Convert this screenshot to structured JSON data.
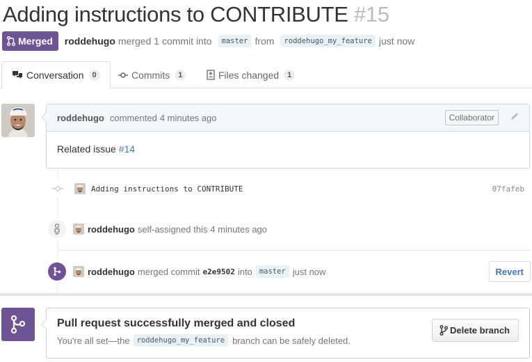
{
  "pr": {
    "title": "Adding instructions to CONTRIBUTE",
    "number": "#15",
    "state": "Merged",
    "author": "roddehugo",
    "action_text": "merged 1 commit into",
    "base_branch": "master",
    "from_text": "from",
    "head_branch": "roddehugo_my_feature",
    "time": "just now"
  },
  "tabs": [
    {
      "label": "Conversation",
      "count": "0",
      "icon": "conversation-icon"
    },
    {
      "label": "Commits",
      "count": "1",
      "icon": "commit-icon"
    },
    {
      "label": "Files changed",
      "count": "1",
      "icon": "diff-icon"
    }
  ],
  "comment": {
    "author": "roddehugo",
    "action": "commented",
    "time": "4 minutes ago",
    "role": "Collaborator",
    "body_text": "Related issue",
    "issue_link": "#14"
  },
  "timeline": {
    "commit": {
      "message": "Adding instructions to CONTRIBUTE",
      "sha": "07fafeb"
    },
    "assign_event": {
      "author": "roddehugo",
      "text": "self-assigned this",
      "time": "4 minutes ago"
    },
    "merge_event": {
      "author": "roddehugo",
      "text": "merged commit",
      "sha": "e2e9502",
      "into": "into",
      "branch": "master",
      "time": "just now",
      "revert_label": "Revert"
    }
  },
  "merge_status": {
    "title": "Pull request successfully merged and closed",
    "desc_prefix": "You're all set—the",
    "branch": "roddehugo_my_feature",
    "desc_suffix": "branch can be safely deleted.",
    "delete_label": "Delete branch"
  },
  "colors": {
    "merged_purple": "#6e5494",
    "link_blue": "#4078c0",
    "branch_bg": "#e8f1f6"
  }
}
